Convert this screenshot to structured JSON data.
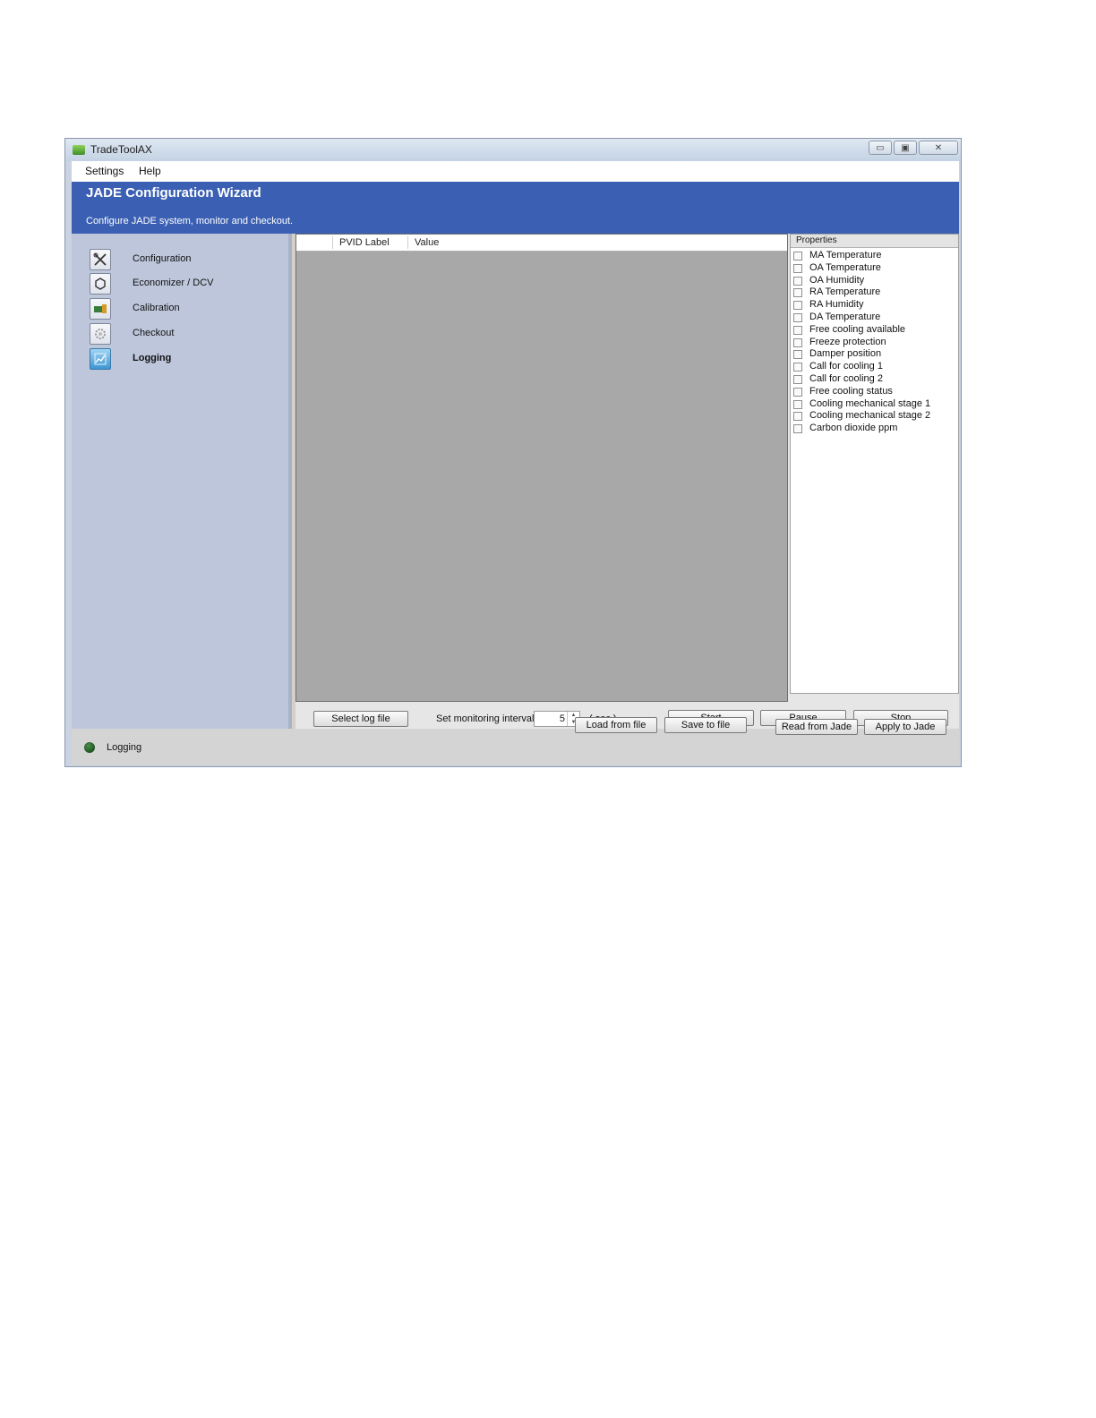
{
  "window": {
    "title": "TradeToolAX",
    "controls": {
      "minimize": "▭",
      "maximize": "▣",
      "close": "✕"
    }
  },
  "menu": {
    "items": [
      "Settings",
      "Help"
    ]
  },
  "banner": {
    "title": "JADE Configuration Wizard",
    "subtitle": "Configure JADE system, monitor and checkout."
  },
  "sidebar": {
    "items": [
      {
        "label": "Configuration",
        "icon": "tools-icon"
      },
      {
        "label": "Economizer / DCV",
        "icon": "economizer-icon"
      },
      {
        "label": "Calibration",
        "icon": "calibration-icon"
      },
      {
        "label": "Checkout",
        "icon": "gear-icon"
      },
      {
        "label": "Logging",
        "icon": "logging-icon",
        "active": true
      }
    ]
  },
  "grid": {
    "columns": [
      "PVID Label",
      "Value"
    ]
  },
  "properties": {
    "title": "Properties",
    "items": [
      "MA Temperature",
      "OA Temperature",
      "OA Humidity",
      "RA Temperature",
      "RA Humidity",
      "DA Temperature",
      "Free cooling available",
      "Freeze protection",
      "Damper position",
      "Call for cooling 1",
      "Call for cooling 2",
      "Free cooling status",
      "Cooling mechanical stage 1",
      "Cooling mechanical stage 2",
      "Carbon dioxide ppm"
    ]
  },
  "controls": {
    "select_log": "Select log file",
    "interval_label": "Set monitoring interval",
    "interval_value": "5",
    "interval_unit": "( sec )",
    "start": "Start",
    "pause": "Pause",
    "stop": "Stop"
  },
  "status": {
    "text": "Logging",
    "led_color": "#1f5a1f",
    "load": "Load from file",
    "save": "Save to  file",
    "read": "Read from Jade",
    "apply": "Apply to Jade"
  },
  "colors": {
    "banner": "#3a5fb3",
    "sidebar": "#bdc6db",
    "grid": "#a8a8a8"
  }
}
